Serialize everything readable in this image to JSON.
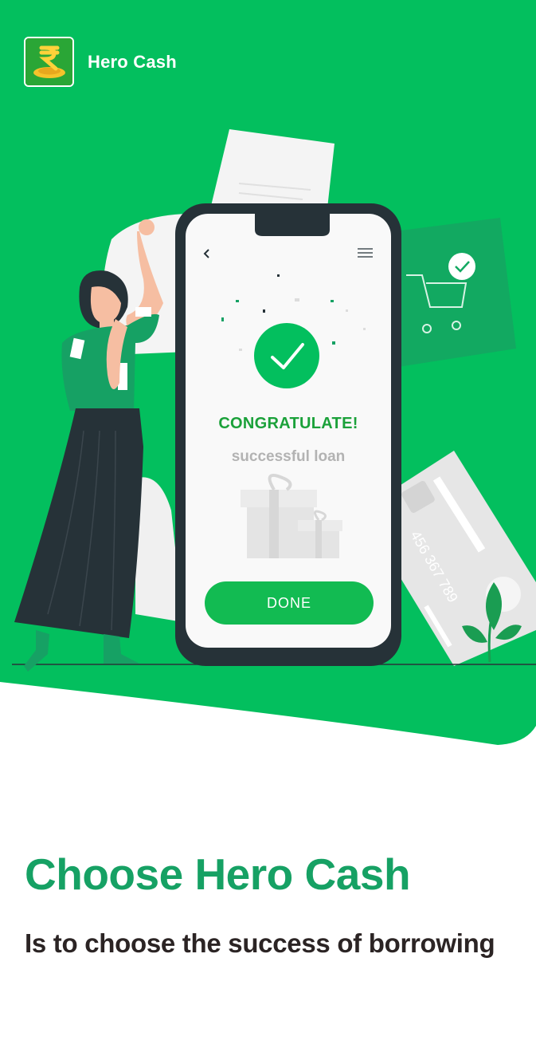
{
  "app": {
    "title": "Hero Cash"
  },
  "icons": {
    "logo": "rupee-coin-logo-icon",
    "back": "chevron-left-icon",
    "menu": "hamburger-menu-icon",
    "success": "checkmark-circle-icon",
    "cart": "shopping-cart-icon",
    "gift": "gift-boxes-icon",
    "card": "credit-card-icon"
  },
  "phone_screen": {
    "congrats": "CONGRATULATE!",
    "subtitle": "successful loan",
    "done_button": "DONE"
  },
  "card": {
    "number": "456 367 789"
  },
  "headline": "Choose Hero Cash",
  "tagline": "Is to choose the success of borrowing",
  "colors": {
    "brand_green": "#03BF5E",
    "headline_green": "#16A164",
    "text_dark": "#2B2424"
  }
}
